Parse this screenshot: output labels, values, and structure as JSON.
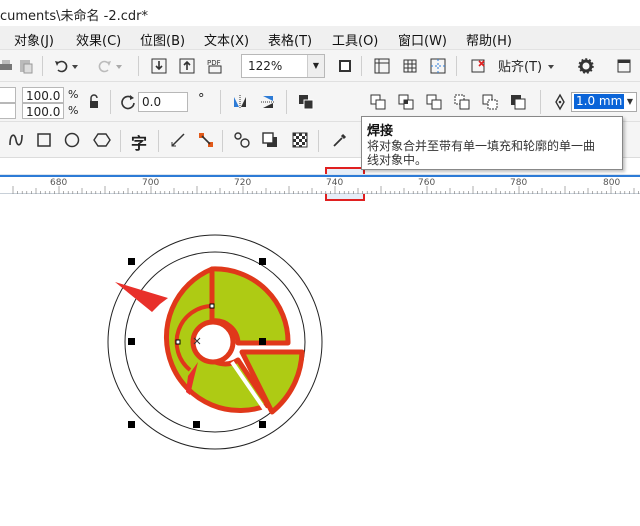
{
  "window": {
    "title": "cuments\\未命名 -2.cdr*"
  },
  "menu": [
    {
      "label": "对象(J)"
    },
    {
      "label": "效果(C)"
    },
    {
      "label": "位图(B)"
    },
    {
      "label": "文本(X)"
    },
    {
      "label": "表格(T)"
    },
    {
      "label": "工具(O)"
    },
    {
      "label": "窗口(W)"
    },
    {
      "label": "帮助(H)"
    }
  ],
  "standard_toolbar": {
    "zoom_value": "122%",
    "snap_label": "贴齐(T)",
    "pdf_label": "PDF"
  },
  "property_bar": {
    "scale_x": "100.0",
    "scale_y": "100.0",
    "percent": "%",
    "rotation": "0.0",
    "degree": "°",
    "outline_width": "1.0 mm"
  },
  "toolbar3": {
    "text_tool": "字"
  },
  "tooltip": {
    "title": "焊接",
    "desc_line1": "将对象合并至带有单一填充和轮廓的单一曲",
    "desc_line2": "线对象中。"
  },
  "ruler": {
    "labels": [
      "680",
      "700",
      "720",
      "740",
      "760",
      "780",
      "800"
    ]
  },
  "colors": {
    "accent_highlight": "#e02020",
    "shape_fill": "#aecb14",
    "shape_outline": "#e0381a",
    "arrow": "#e8302a",
    "ruler_line": "#2d7bd6"
  }
}
